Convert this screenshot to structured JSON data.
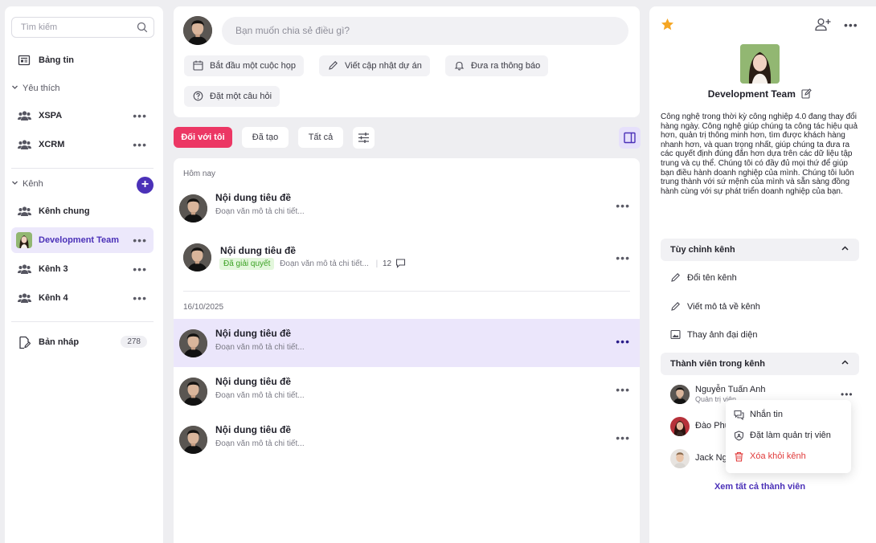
{
  "search": {
    "placeholder": "Tìm kiếm"
  },
  "sidebar": {
    "news": "Bảng tin",
    "favorites_label": "Yêu thích",
    "favorites": [
      {
        "label": "XSPA"
      },
      {
        "label": "XCRM"
      }
    ],
    "channels_label": "Kênh",
    "channels": [
      {
        "label": "Kênh chung"
      },
      {
        "label": "Development Team"
      },
      {
        "label": "Kênh 3"
      },
      {
        "label": "Kênh 4"
      }
    ],
    "drafts": {
      "label": "Bản nháp",
      "count": "278"
    }
  },
  "composer": {
    "placeholder": "Bạn muốn chia sẻ điều gì?",
    "actions": [
      {
        "label": "Bắt đầu một cuộc họp"
      },
      {
        "label": "Viết cập nhật dự án"
      },
      {
        "label": "Đưa ra thông báo"
      },
      {
        "label": "Đặt một câu hỏi"
      }
    ]
  },
  "filters": {
    "tabs": [
      {
        "label": "Đối với tôi"
      },
      {
        "label": "Đã tạo"
      },
      {
        "label": "Tất cả"
      }
    ]
  },
  "feed": {
    "groups": [
      {
        "date": "Hôm nay"
      },
      {
        "date": "16/10/2025"
      }
    ],
    "items": [
      {
        "title": "Nội dung tiêu đề",
        "desc": "Đoạn văn mô tả chi tiết..."
      },
      {
        "title": "Nội dung tiêu đề",
        "status": "Đã giải quyết",
        "desc": "Đoạn văn mô tả chi tiết...",
        "comments": "12"
      },
      {
        "title": "Nội dung tiêu đề",
        "desc": "Đoạn văn mô tả chi tiết..."
      },
      {
        "title": "Nội dung tiêu đề",
        "desc": "Đoạn văn mô tả chi tiết..."
      },
      {
        "title": "Nội dung tiêu đề",
        "desc": "Đoạn văn mô tả chi tiết..."
      }
    ]
  },
  "channel": {
    "name": "Development Team",
    "description": "Công nghệ trong thời kỳ công nghiệp 4.0 đang thay đổi hàng ngày. Công nghệ giúp chúng ta công tác hiệu quả hơn, quản trị thông minh hơn, tìm được khách hàng nhanh hơn, và quan trọng nhất, giúp chúng ta đưa ra các quyết định đúng đắn hơn dựa trên các dữ liệu tập trung và cụ thể. Chúng tôi có đầy đủ mọi thứ để giúp bạn điều hành doanh nghiệp của mình. Chúng tôi luôn trung thành với sứ mệnh của mình và sẵn sàng đồng hành cùng với sự phát triển doanh nghiệp của bạn.",
    "customize": {
      "label": "Tùy chỉnh kênh",
      "options": [
        {
          "label": "Đổi tên kênh"
        },
        {
          "label": "Viết mô tả về kênh"
        },
        {
          "label": "Thay ảnh đại diện"
        }
      ]
    },
    "members": {
      "label": "Thành viên trong kênh",
      "list": [
        {
          "name": "Nguyễn Tuấn Anh",
          "role": "Quản trị viên"
        },
        {
          "name": "Đào Phư"
        },
        {
          "name": "Jack Ng"
        }
      ],
      "see_all": "Xem tất cả thành viên"
    },
    "member_menu": [
      {
        "label": "Nhắn tin"
      },
      {
        "label": "Đặt làm quản trị viên"
      },
      {
        "label": "Xóa khỏi kênh"
      }
    ]
  },
  "colors": {
    "accent": "#4b31b8",
    "primary_tab": "#ec3764",
    "selected_row": "#ebe6fb",
    "star": "#f5a623",
    "danger": "#e03a3a",
    "resolved": "#3ba224"
  }
}
